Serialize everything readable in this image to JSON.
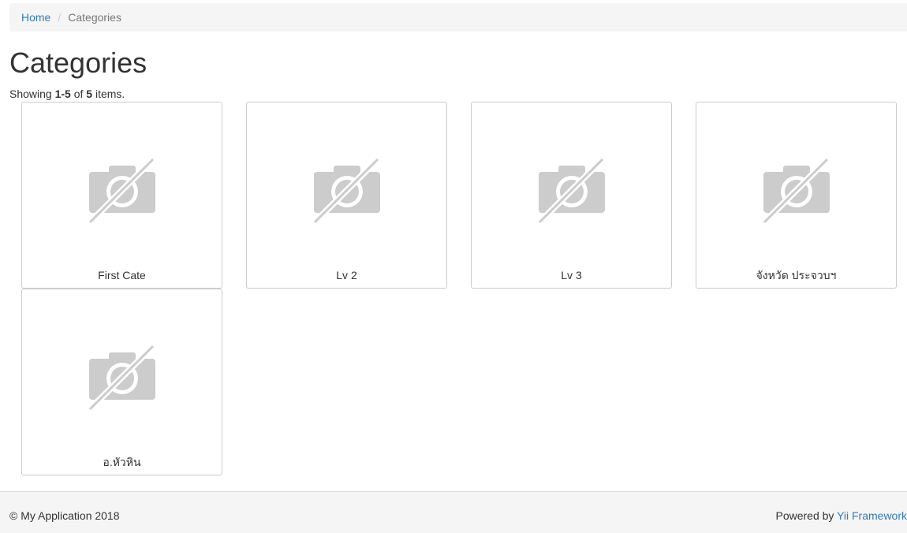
{
  "breadcrumb": {
    "home": "Home",
    "separator": "/",
    "current": "Categories"
  },
  "page": {
    "title": "Categories"
  },
  "summary": {
    "prefix": "Showing ",
    "range": "1-5",
    "of": " of ",
    "total": "5",
    "suffix": " items."
  },
  "items": [
    {
      "label": "First Cate",
      "icon": "no-photo-icon"
    },
    {
      "label": "Lv 2",
      "icon": "no-photo-icon"
    },
    {
      "label": "Lv 3",
      "icon": "no-photo-icon"
    },
    {
      "label": "จังหวัด ประจวบฯ",
      "icon": "no-photo-icon"
    },
    {
      "label": "อ.หัวหิน",
      "icon": "no-photo-icon"
    }
  ],
  "footer": {
    "copyright": "© My Application 2018",
    "powered_prefix": "Powered by ",
    "powered_link": "Yii Framework"
  },
  "colors": {
    "link": "#337ab7",
    "panel": "#f5f5f5",
    "border": "#cccccc",
    "icon": "#cccccc"
  }
}
